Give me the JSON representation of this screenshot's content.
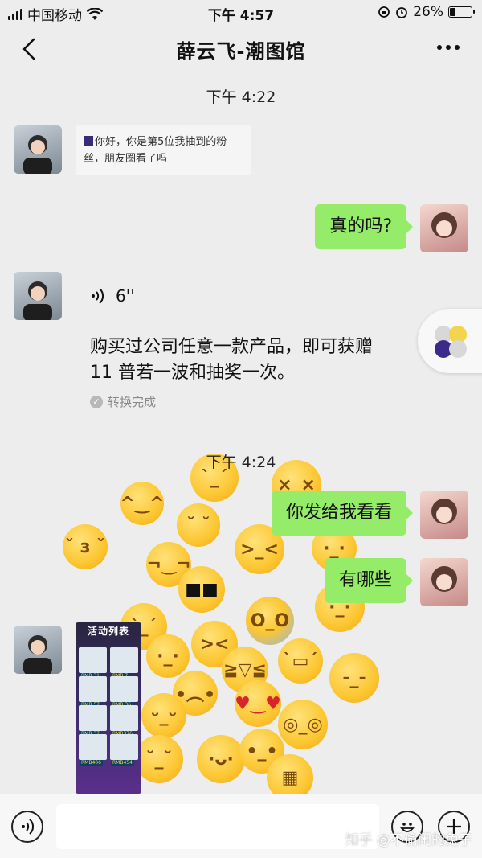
{
  "status_bar": {
    "carrier": "中国移动",
    "time": "下午 4:57",
    "battery": "26%",
    "battery_level": 0.26
  },
  "nav": {
    "title": "薛云飞-潮图馆"
  },
  "chat": {
    "timestamps": [
      "下午 4:22",
      "下午 4:24"
    ],
    "messages": {
      "m1": "你好，你是第5位我抽到的粉丝，朋友圈看了吗",
      "m2": "真的吗?",
      "voice_duration": "6''",
      "transcript": "购买过公司任意一款产品，即可获赠 11 普若一波和抽奖一次。",
      "transcript_status": "转换完成",
      "m3": "你发给我看看",
      "m4": "有哪些"
    },
    "poster": {
      "title": "活动列表",
      "prices": [
        "RMB 31",
        "RMB 7",
        "RMB 57",
        "RMB 36",
        "RMB 37",
        "RMB376",
        "RMB406",
        "RMB454"
      ]
    }
  },
  "bottom_bar": {
    "watermark": "知乎 @不偷闲的兔子"
  }
}
